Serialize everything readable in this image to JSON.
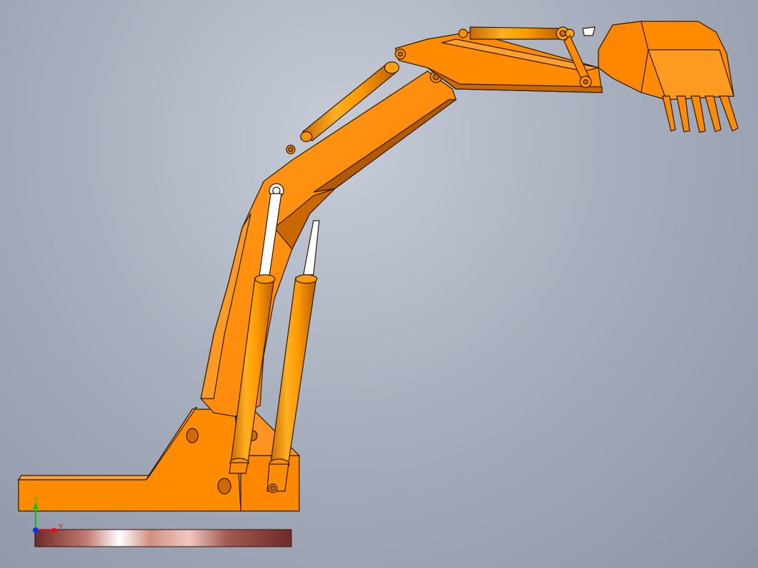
{
  "viewport": {
    "background_top": "#c6ccd7",
    "background_bottom": "#8c94a6"
  },
  "model": {
    "description_icon": "excavator-arm-model",
    "body_color": "#ff8c00",
    "body_shadow_color": "#b35a00",
    "edge_color": "#2b1a00",
    "rod_color": "#ffffff",
    "cylinder_color": "#ffa310"
  },
  "triad": {
    "x_axis_label": "",
    "y_axis_label": "Y",
    "y_vertical_label": "Y",
    "x_color": "#e01010",
    "y_color": "#10c010",
    "z_color": "#1030e0"
  },
  "floor_plate": {
    "color_dark": "#6e2a26",
    "color_light": "#ffffff"
  }
}
